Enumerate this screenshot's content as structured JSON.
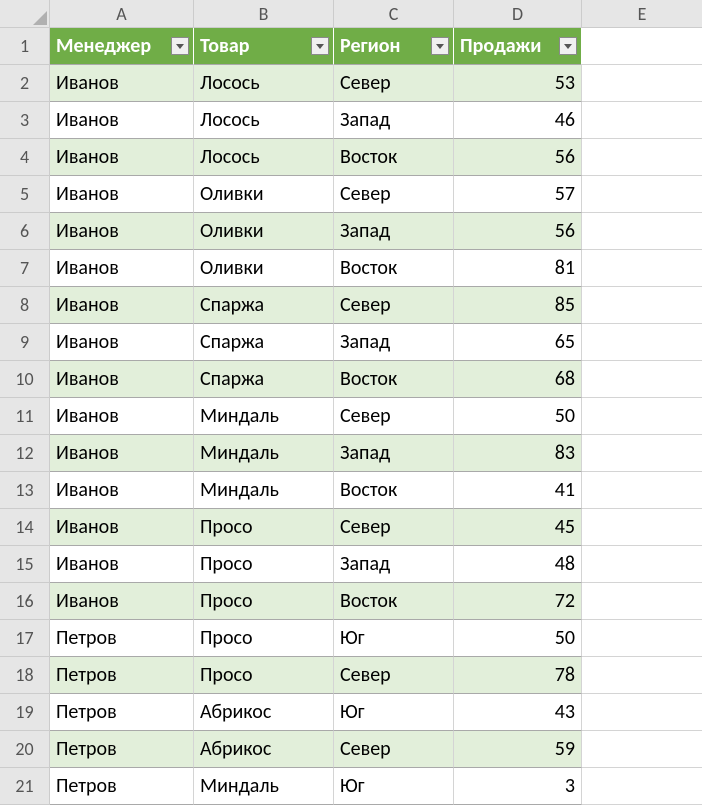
{
  "columns": [
    "A",
    "B",
    "C",
    "D",
    "E"
  ],
  "headers": [
    "Менеджер",
    "Товар",
    "Регион",
    "Продажи"
  ],
  "rows": [
    {
      "n": 2,
      "manager": "Иванов",
      "product": "Лосось",
      "region": "Север",
      "sales": 53
    },
    {
      "n": 3,
      "manager": "Иванов",
      "product": "Лосось",
      "region": "Запад",
      "sales": 46
    },
    {
      "n": 4,
      "manager": "Иванов",
      "product": "Лосось",
      "region": "Восток",
      "sales": 56
    },
    {
      "n": 5,
      "manager": "Иванов",
      "product": "Оливки",
      "region": "Север",
      "sales": 57
    },
    {
      "n": 6,
      "manager": "Иванов",
      "product": "Оливки",
      "region": "Запад",
      "sales": 56
    },
    {
      "n": 7,
      "manager": "Иванов",
      "product": "Оливки",
      "region": "Восток",
      "sales": 81
    },
    {
      "n": 8,
      "manager": "Иванов",
      "product": "Спаржа",
      "region": "Север",
      "sales": 85
    },
    {
      "n": 9,
      "manager": "Иванов",
      "product": "Спаржа",
      "region": "Запад",
      "sales": 65
    },
    {
      "n": 10,
      "manager": "Иванов",
      "product": "Спаржа",
      "region": "Восток",
      "sales": 68
    },
    {
      "n": 11,
      "manager": "Иванов",
      "product": "Миндаль",
      "region": "Север",
      "sales": 50
    },
    {
      "n": 12,
      "manager": "Иванов",
      "product": "Миндаль",
      "region": "Запад",
      "sales": 83
    },
    {
      "n": 13,
      "manager": "Иванов",
      "product": "Миндаль",
      "region": "Восток",
      "sales": 41
    },
    {
      "n": 14,
      "manager": "Иванов",
      "product": "Просо",
      "region": "Север",
      "sales": 45
    },
    {
      "n": 15,
      "manager": "Иванов",
      "product": "Просо",
      "region": "Запад",
      "sales": 48
    },
    {
      "n": 16,
      "manager": "Иванов",
      "product": "Просо",
      "region": "Восток",
      "sales": 72
    },
    {
      "n": 17,
      "manager": "Петров",
      "product": "Просо",
      "region": "Юг",
      "sales": 50
    },
    {
      "n": 18,
      "manager": "Петров",
      "product": "Просо",
      "region": "Север",
      "sales": 78
    },
    {
      "n": 19,
      "manager": "Петров",
      "product": "Абрикос",
      "region": "Юг",
      "sales": 43
    },
    {
      "n": 20,
      "manager": "Петров",
      "product": "Абрикос",
      "region": "Север",
      "sales": 59
    },
    {
      "n": 21,
      "manager": "Петров",
      "product": "Миндаль",
      "region": "Юг",
      "sales": 3
    }
  ],
  "header_row_num": 1
}
